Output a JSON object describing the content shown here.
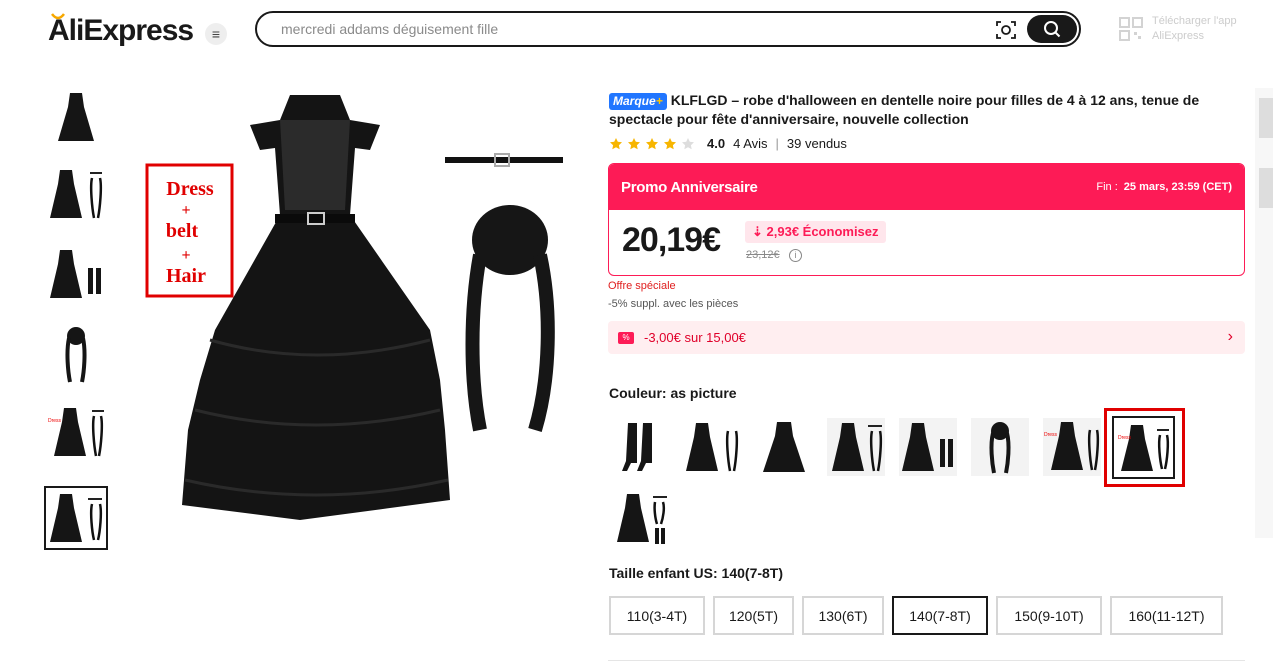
{
  "header": {
    "logo": "AliExpress",
    "search_placeholder": "mercredi addams déguisement fille",
    "app_text_1": "Télécharger l'app",
    "app_text_2": "AliExpress"
  },
  "gallery": {
    "main_image_overlay": [
      "Dress",
      "+",
      "belt",
      "+",
      "Hair"
    ],
    "thumb_count": 6,
    "selected_thumb": 6
  },
  "product": {
    "brand_badge": "Marque",
    "brand_plus": "+",
    "title": "KLFLGD – robe d'halloween en dentelle noire pour filles de 4 à 12 ans, tenue de spectacle pour fête d'anniversaire, nouvelle collection",
    "rating": "4.0",
    "stars": 4,
    "reviews": "4 Avis",
    "sold": "39 vendus"
  },
  "promo": {
    "title": "Promo Anniversaire",
    "end_label": "Fin :",
    "end_date": "25 mars, 23:59 (CET)",
    "price": "20,19€",
    "savings": "2,93€ Économisez",
    "old_price": "23,12€",
    "special": "Offre spéciale",
    "coins": "-5% suppl. avec les pièces",
    "coupon": "-3,00€ sur 15,00€"
  },
  "color": {
    "label": "Couleur:",
    "value": "as picture"
  },
  "size": {
    "label": "Taille enfant US:",
    "value": "140(7-8T)",
    "options": [
      "110(3-4T)",
      "120(5T)",
      "130(6T)",
      "140(7-8T)",
      "150(9-10T)",
      "160(11-12T)"
    ],
    "selected": "140(7-8T)"
  },
  "colors": {
    "accent": "#fd1b56",
    "brand_blue": "#2176ff",
    "highlight": "#e00000"
  }
}
